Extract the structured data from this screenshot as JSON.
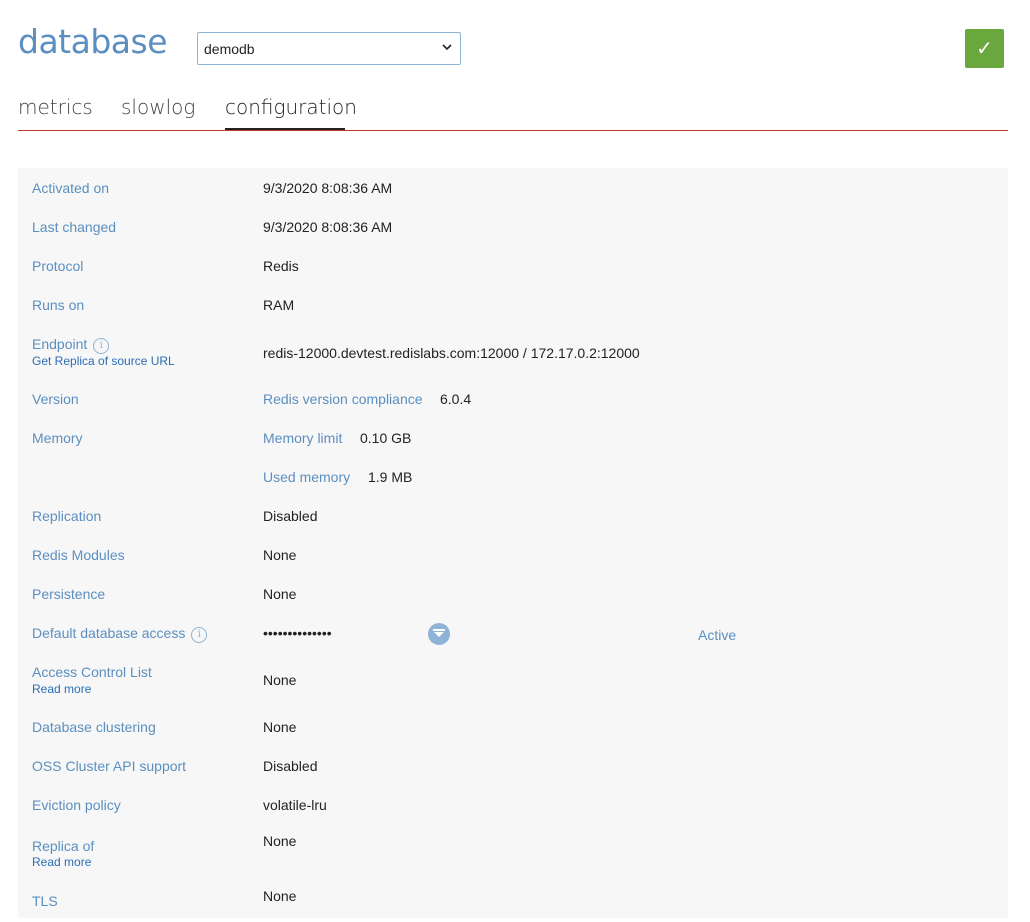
{
  "header": {
    "title": "database",
    "db_select": {
      "value": "demodb"
    },
    "confirm_icon": "checkmark-icon",
    "confirm_symbol": "✓"
  },
  "tabs": [
    {
      "label": "metrics",
      "active": false
    },
    {
      "label": "slowlog",
      "active": false
    },
    {
      "label": "configuration",
      "active": true
    }
  ],
  "colors": {
    "accent": "#5b8fc0",
    "tab_rule": "#c0392b",
    "confirm": "#6aa73c",
    "row_bg": "#f7f7f7"
  },
  "config": {
    "activated_on": {
      "label": "Activated on",
      "value": "9/3/2020 8:08:36 AM"
    },
    "last_changed": {
      "label": "Last changed",
      "value": "9/3/2020 8:08:36 AM"
    },
    "protocol": {
      "label": "Protocol",
      "value": "Redis"
    },
    "runs_on": {
      "label": "Runs on",
      "value": "RAM"
    },
    "endpoint": {
      "label": "Endpoint",
      "link": "Get Replica of source URL",
      "value": "redis-12000.devtest.redislabs.com:12000 / 172.17.0.2:12000"
    },
    "version": {
      "label": "Version",
      "key": "Redis version compliance",
      "value": "6.0.4"
    },
    "memory": {
      "label": "Memory",
      "limit_key": "Memory limit",
      "limit_value": "0.10 GB",
      "used_key": "Used memory",
      "used_value": "1.9 MB"
    },
    "replication": {
      "label": "Replication",
      "value": "Disabled"
    },
    "modules": {
      "label": "Redis Modules",
      "value": "None"
    },
    "persistence": {
      "label": "Persistence",
      "value": "None"
    },
    "default_access": {
      "label": "Default database access",
      "password": "••••••••••••••",
      "status": "Active"
    },
    "acl": {
      "label": "Access Control List",
      "link": "Read more",
      "value": "None"
    },
    "clustering": {
      "label": "Database clustering",
      "value": "None"
    },
    "oss_cluster": {
      "label": "OSS Cluster API support",
      "value": "Disabled"
    },
    "eviction": {
      "label": "Eviction policy",
      "value": "volatile-lru"
    },
    "replica_of": {
      "label": "Replica of",
      "link": "Read more",
      "value": "None"
    },
    "tls": {
      "label": "TLS",
      "value": "None"
    }
  }
}
